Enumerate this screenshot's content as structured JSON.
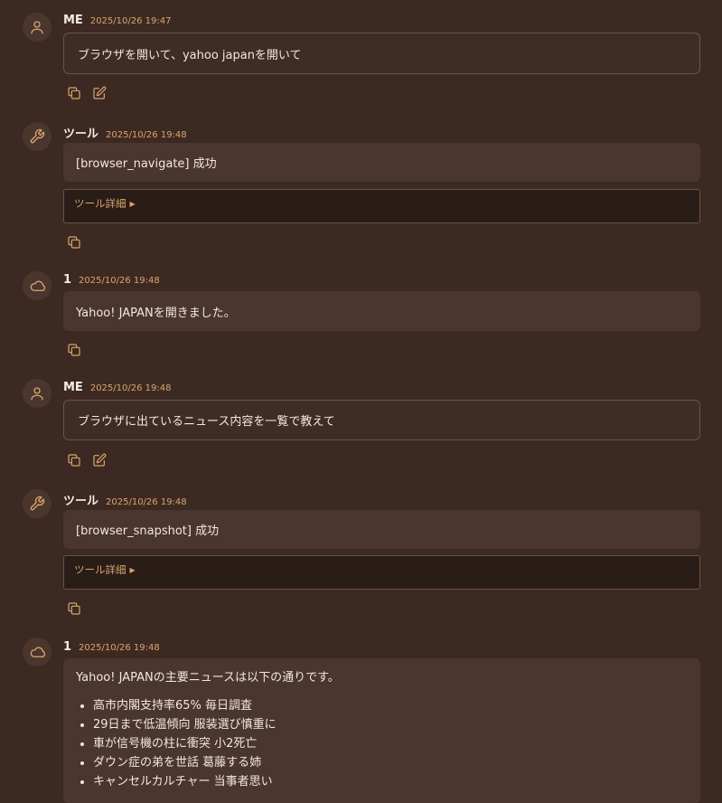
{
  "messages": [
    {
      "sender": "ME",
      "time": "2025/10/26 19:47",
      "text": "ブラウザを開いて、yahoo japanを開いて",
      "avatar_icon": "user-icon"
    },
    {
      "sender": "ツール",
      "time": "2025/10/26 19:48",
      "text": "[browser_navigate] 成功",
      "details_label": "ツール詳細",
      "avatar_icon": "wrench-icon"
    },
    {
      "sender": "1",
      "time": "2025/10/26 19:48",
      "text": "Yahoo! JAPANを開きました。",
      "avatar_icon": "cloud-icon"
    },
    {
      "sender": "ME",
      "time": "2025/10/26 19:48",
      "text": "ブラウザに出ているニュース内容を一覧で教えて",
      "avatar_icon": "user-icon"
    },
    {
      "sender": "ツール",
      "time": "2025/10/26 19:48",
      "text": "[browser_snapshot] 成功",
      "details_label": "ツール詳細",
      "avatar_icon": "wrench-icon"
    },
    {
      "sender": "1",
      "time": "2025/10/26 19:48",
      "text": "Yahoo! JAPANの主要ニュースは以下の通りです。",
      "avatar_icon": "cloud-icon",
      "news": [
        "高市内閣支持率65% 毎日調査",
        "29日まで低温傾向 服装選び慎重に",
        "車が信号機の柱に衝突 小2死亡",
        "ダウン症の弟を世話 葛藤する姉",
        "キャンセルカルチャー 当事者思い"
      ]
    }
  ],
  "colors": {
    "accent": "#d9a56e",
    "background": "#3c2a22",
    "bubble": "#4a362d",
    "details_bg": "#2a1c16"
  }
}
